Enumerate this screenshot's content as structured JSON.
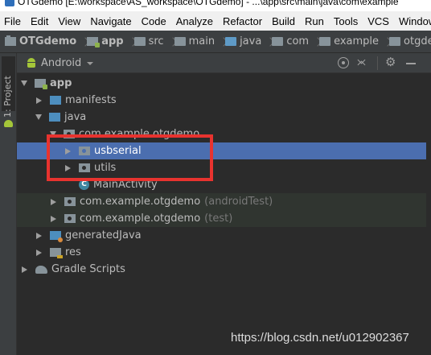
{
  "window": {
    "title": "OTGdemo [E:\\workspace\\AS_workspace\\OTGdemo] - ...\\app\\src\\main\\java\\com\\example"
  },
  "menu": {
    "items": [
      {
        "label": "File"
      },
      {
        "label": "Edit"
      },
      {
        "label": "View"
      },
      {
        "label": "Navigate"
      },
      {
        "label": "Code"
      },
      {
        "label": "Analyze"
      },
      {
        "label": "Refactor"
      },
      {
        "label": "Build"
      },
      {
        "label": "Run"
      },
      {
        "label": "Tools"
      },
      {
        "label": "VCS"
      },
      {
        "label": "Window"
      }
    ]
  },
  "breadcrumb": {
    "items": [
      {
        "label": "OTGdemo",
        "icon": "project-folder-icon"
      },
      {
        "label": "app",
        "icon": "module-folder-icon"
      },
      {
        "label": "src",
        "icon": "folder-icon"
      },
      {
        "label": "main",
        "icon": "folder-icon"
      },
      {
        "label": "java",
        "icon": "source-folder-icon"
      },
      {
        "label": "com",
        "icon": "package-icon"
      },
      {
        "label": "example",
        "icon": "package-icon"
      },
      {
        "label": "otgdemo",
        "icon": "package-icon"
      }
    ]
  },
  "toolstrip": {
    "project_tab": "1: Project"
  },
  "panel": {
    "title": "Android",
    "gear_glyph": "⚙"
  },
  "tree": {
    "rows": [
      {
        "label": "app"
      },
      {
        "label": "manifests"
      },
      {
        "label": "java"
      },
      {
        "label": "com.example.otgdemo"
      },
      {
        "label": "usbserial"
      },
      {
        "label": "utils"
      },
      {
        "label": "MainActivity",
        "icon_letter": "C"
      },
      {
        "label": "com.example.otgdemo",
        "suffix": "(androidTest)"
      },
      {
        "label": "com.example.otgdemo",
        "suffix": "(test)"
      },
      {
        "label": "generatedJava"
      },
      {
        "label": "res"
      },
      {
        "label": "Gradle Scripts"
      }
    ]
  },
  "watermark": "https://blog.csdn.net/u012902367",
  "colors": {
    "selection": "#4b6eaf",
    "highlight_box": "#e8332f",
    "background": "#2b2b2b"
  }
}
